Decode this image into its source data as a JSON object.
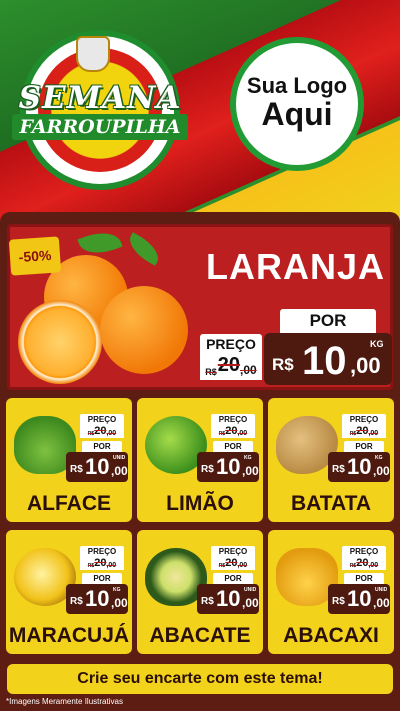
{
  "header": {
    "brand_line1": "SEMANA",
    "brand_line2": "FARROUPILHA",
    "logo_placeholder_line1": "Sua Logo",
    "logo_placeholder_line2": "Aqui"
  },
  "colors": {
    "flag_green": "#2c8f2c",
    "flag_red": "#e0201c",
    "flag_yellow": "#f6c21a",
    "panel_brown": "#5d1d12",
    "card_yellow": "#f2d21a",
    "price_box": "#4e1a10"
  },
  "featured": {
    "name": "LARANJA",
    "discount": "-50%",
    "old_label": "PREÇO",
    "old_currency": "R$",
    "old_int": "20",
    "old_cents": ",00",
    "new_label": "POR",
    "new_currency": "R$",
    "new_int": "10",
    "new_cents": ",00",
    "unit": "KG"
  },
  "products": [
    {
      "name": "ALFACE",
      "old_label": "PREÇO",
      "old_currency": "R$",
      "old_int": "20",
      "old_cents": ",00",
      "new_label": "POR",
      "new_currency": "R$",
      "new_int": "10",
      "new_cents": ",00",
      "unit": "UNID",
      "icon": "lettuce-icon"
    },
    {
      "name": "LIMÃO",
      "old_label": "PREÇO",
      "old_currency": "R$",
      "old_int": "20",
      "old_cents": ",00",
      "new_label": "POR",
      "new_currency": "R$",
      "new_int": "10",
      "new_cents": ",00",
      "unit": "KG",
      "icon": "lime-icon"
    },
    {
      "name": "BATATA",
      "old_label": "PREÇO",
      "old_currency": "R$",
      "old_int": "20",
      "old_cents": ",00",
      "new_label": "POR",
      "new_currency": "R$",
      "new_int": "10",
      "new_cents": ",00",
      "unit": "KG",
      "icon": "potato-icon"
    },
    {
      "name": "MARACUJÁ",
      "old_label": "PREÇO",
      "old_currency": "R$",
      "old_int": "20",
      "old_cents": ",00",
      "new_label": "POR",
      "new_currency": "R$",
      "new_int": "10",
      "new_cents": ",00",
      "unit": "KG",
      "icon": "passion-fruit-icon"
    },
    {
      "name": "ABACATE",
      "old_label": "PREÇO",
      "old_currency": "R$",
      "old_int": "20",
      "old_cents": ",00",
      "new_label": "POR",
      "new_currency": "R$",
      "new_int": "10",
      "new_cents": ",00",
      "unit": "UNID",
      "icon": "avocado-icon"
    },
    {
      "name": "ABACAXI",
      "old_label": "PREÇO",
      "old_currency": "R$",
      "old_int": "20",
      "old_cents": ",00",
      "new_label": "POR",
      "new_currency": "R$",
      "new_int": "10",
      "new_cents": ",00",
      "unit": "UNID",
      "icon": "pineapple-icon"
    }
  ],
  "footer": {
    "cta": "Crie seu encarte com este tema!",
    "disclaimer": "*Imagens Meramente Ilustrativas"
  }
}
